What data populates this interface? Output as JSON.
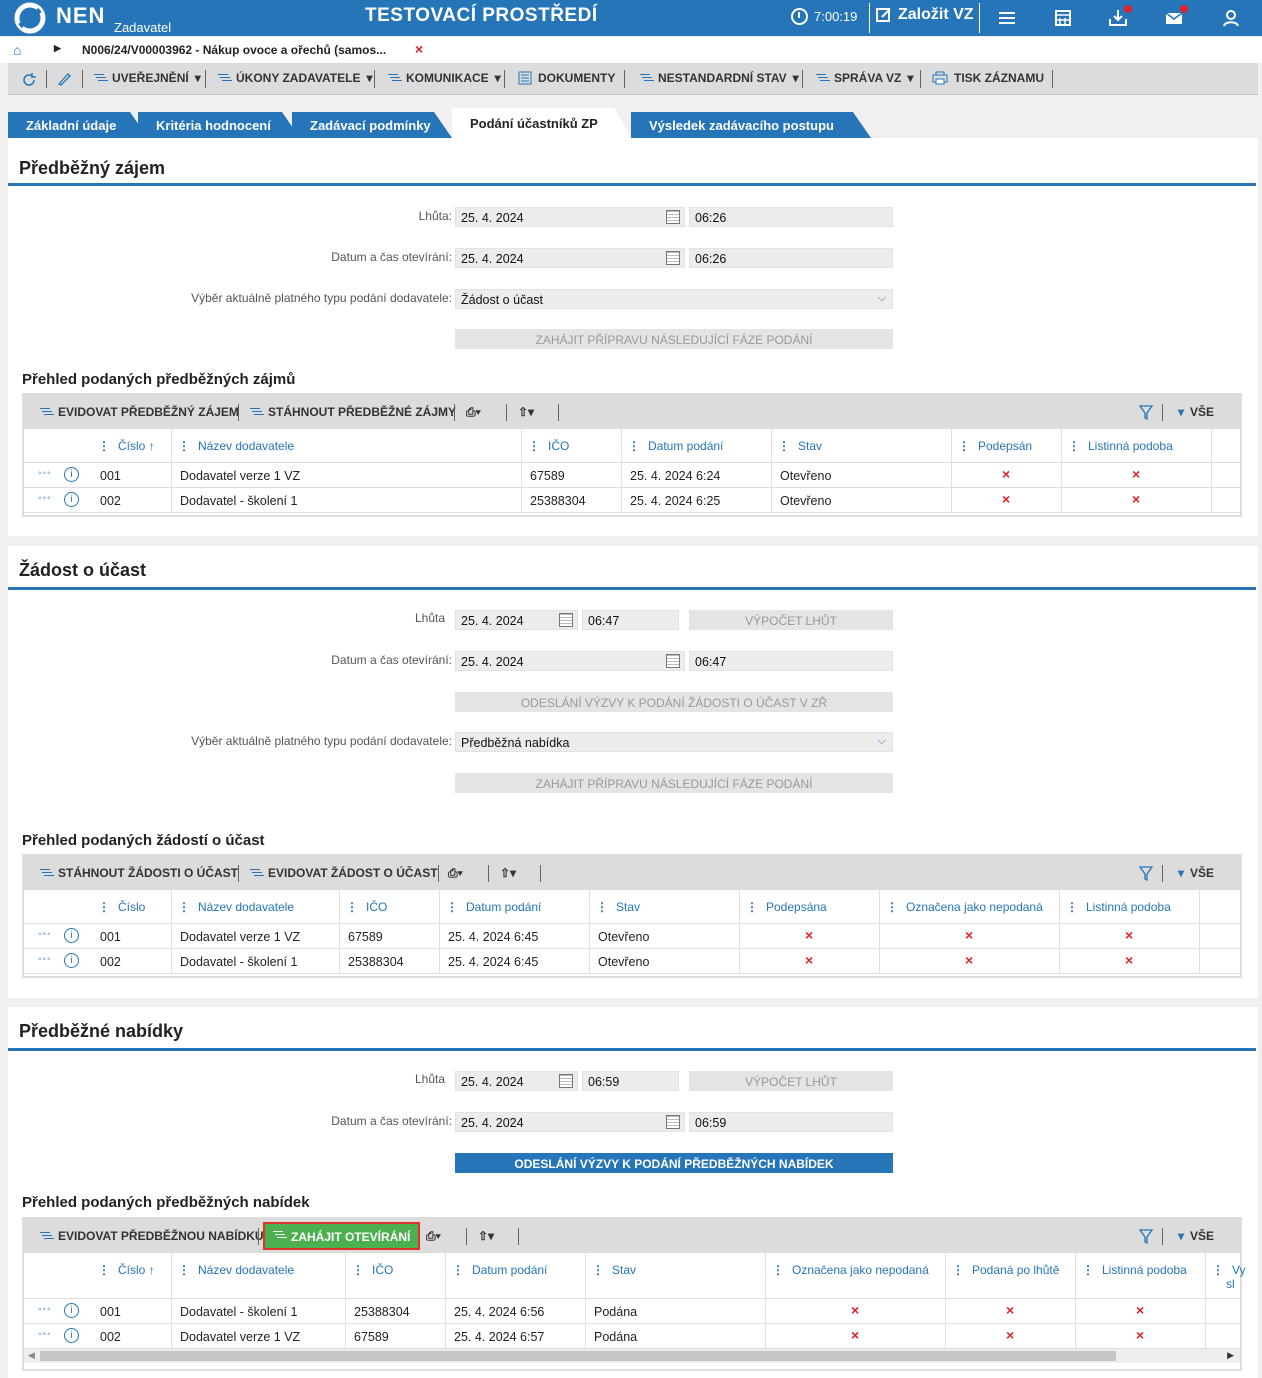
{
  "header": {
    "logo": "NEN",
    "subtitle": "Zadavatel",
    "env": "TESTOVACÍ PROSTŘEDÍ",
    "time": "7:00:19",
    "new_vz": "Založit VZ"
  },
  "breadcrumb": {
    "text": "N006/24/V00003962 - Nákup ovoce a ořechů (samos..."
  },
  "toolbar": [
    "UVEŘEJNĚNÍ",
    "ÚKONY ZADAVATELE",
    "KOMUNIKACE",
    "DOKUMENTY",
    "NESTANDARDNÍ STAV",
    "SPRÁVA VZ",
    "TISK ZÁZNAMU"
  ],
  "tabs": [
    "Základní údaje",
    "Kritéria hodnocení",
    "Zadávací podmínky",
    "Podání účastníků ZP",
    "Výsledek zadávacího postupu"
  ],
  "s1": {
    "title": "Předběžný zájem",
    "lhuta_label": "Lhůta:",
    "lhuta_date": "25. 4. 2024",
    "lhuta_time": "06:26",
    "open_label": "Datum a čas otevírání:",
    "open_date": "25. 4. 2024",
    "open_time": "06:26",
    "typ_label": "Výběr aktuálně platného typu podání dodavatele:",
    "typ_value": "Žádost o účast",
    "btn_next": "ZAHÁJIT PŘÍPRAVU NÁSLEDUJÍCÍ FÁZE PODÁNÍ",
    "grid_title": "Přehled podaných předběžných zájmů",
    "gt1": "EVIDOVAT PŘEDBĚŽNÝ ZÁJEM",
    "gt2": "STÁHNOUT PŘEDBĚŽNÉ ZÁJMY",
    "all": "VŠE",
    "cols": [
      "Číslo",
      "Název dodavatele",
      "IČO",
      "Datum podání",
      "Stav",
      "Podepsán",
      "Listinná podoba"
    ],
    "rows": [
      [
        "001",
        "Dodavatel verze 1 VZ",
        "67589",
        "25. 4. 2024 6:24",
        "Otevřeno"
      ],
      [
        "002",
        "Dodavatel - školení 1",
        "25388304",
        "25. 4. 2024 6:25",
        "Otevřeno"
      ]
    ]
  },
  "s2": {
    "title": "Žádost o účast",
    "lhuta_label": "Lhůta",
    "lhuta_date": "25. 4. 2024",
    "lhuta_time": "06:47",
    "calc": "VÝPOČET LHŮT",
    "open_label": "Datum a čas otevírání:",
    "open_date": "25. 4. 2024",
    "open_time": "06:47",
    "btn_send": "ODESLÁNÍ VÝZVY K PODÁNÍ ŽÁDOSTI O ÚČAST V ZŘ",
    "typ_label": "Výběr aktuálně platného typu podání dodavatele:",
    "typ_value": "Předběžná nabídka",
    "btn_next": "ZAHÁJIT PŘÍPRAVU NÁSLEDUJÍCÍ FÁZE PODÁNÍ",
    "grid_title": "Přehled podaných žádostí o účast",
    "gt1": "STÁHNOUT ŽÁDOSTI O ÚČAST",
    "gt2": "EVIDOVAT ŽÁDOST O ÚČAST",
    "all": "VŠE",
    "cols": [
      "Číslo",
      "Název dodavatele",
      "IČO",
      "Datum podání",
      "Stav",
      "Podepsána",
      "Označena jako nepodaná",
      "Listinná podoba"
    ],
    "rows": [
      [
        "001",
        "Dodavatel verze 1 VZ",
        "67589",
        "25. 4. 2024 6:45",
        "Otevřeno"
      ],
      [
        "002",
        "Dodavatel - školení 1",
        "25388304",
        "25. 4. 2024 6:45",
        "Otevřeno"
      ]
    ]
  },
  "s3": {
    "title": "Předběžné nabídky",
    "lhuta_label": "Lhůta",
    "lhuta_date": "25. 4. 2024",
    "lhuta_time": "06:59",
    "calc": "VÝPOČET LHŮT",
    "open_label": "Datum a čas otevírání:",
    "open_date": "25. 4. 2024",
    "open_time": "06:59",
    "btn_send": "ODESLÁNÍ VÝZVY K PODÁNÍ PŘEDBĚŽNÝCH NABÍDEK",
    "grid_title": "Přehled podaných předběžných nabídek",
    "gt1": "EVIDOVAT PŘEDBĚŽNOU NABÍDKU",
    "gt2": "ZAHÁJIT OTEVÍRÁNÍ",
    "all": "VŠE",
    "cols": [
      "Číslo",
      "Název dodavatele",
      "IČO",
      "Datum podání",
      "Stav",
      "Označena jako nepodaná",
      "Podaná po lhůtě",
      "Listinná podoba",
      "Vy",
      "sl"
    ],
    "rows": [
      [
        "001",
        "Dodavatel - školení 1",
        "25388304",
        "25. 4. 2024 6:56",
        "Podána"
      ],
      [
        "002",
        "Dodavatel verze 1 VZ",
        "67589",
        "25. 4. 2024 6:57",
        "Podána"
      ]
    ]
  },
  "icons": {
    "x": "×",
    "sort": "↑",
    "chev": "⌵",
    "dots": "◦◦◦",
    "info": "i"
  }
}
